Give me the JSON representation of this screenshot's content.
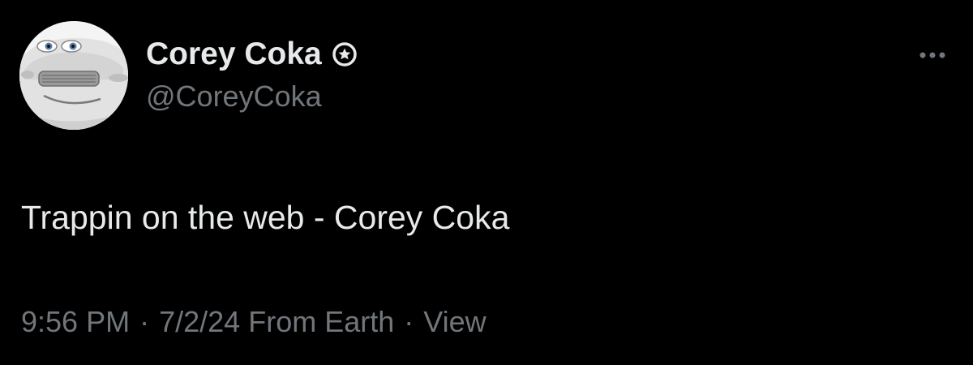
{
  "tweet": {
    "author": {
      "display_name": "Corey Coka",
      "handle": "@CoreyCoka",
      "badge_icon": "verified-star-badge-icon",
      "avatar_icon": "car-face-avatar"
    },
    "more_icon": "more-horizontal-icon",
    "text": "Trappin on the web - Corey Coka",
    "meta": {
      "time": "9:56 PM",
      "separator": "·",
      "date": "7/2/24",
      "location": "From Earth",
      "views_label": "View"
    },
    "colors": {
      "background": "#000000",
      "primary_text": "#e7e9ea",
      "secondary_text": "#71767b"
    }
  }
}
